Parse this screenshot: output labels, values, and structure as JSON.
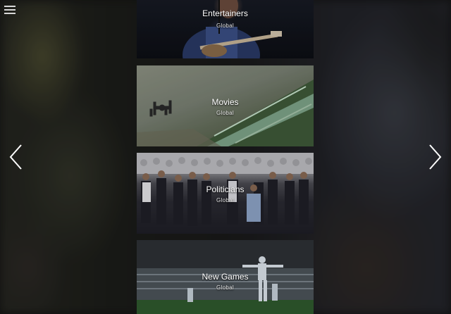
{
  "nav": {
    "menu_icon": "hamburger-menu-icon",
    "prev_icon": "chevron-left-icon",
    "next_icon": "chevron-right-icon"
  },
  "cards": [
    {
      "title": "Entertainers",
      "subtitle": "Global"
    },
    {
      "title": "Movies",
      "subtitle": "Global"
    },
    {
      "title": "Politicians",
      "subtitle": "Global"
    },
    {
      "title": "New Games",
      "subtitle": "Global"
    }
  ],
  "colors": {
    "text": "#ffffff",
    "icon": "#d8d8d8",
    "background": "#141414"
  }
}
